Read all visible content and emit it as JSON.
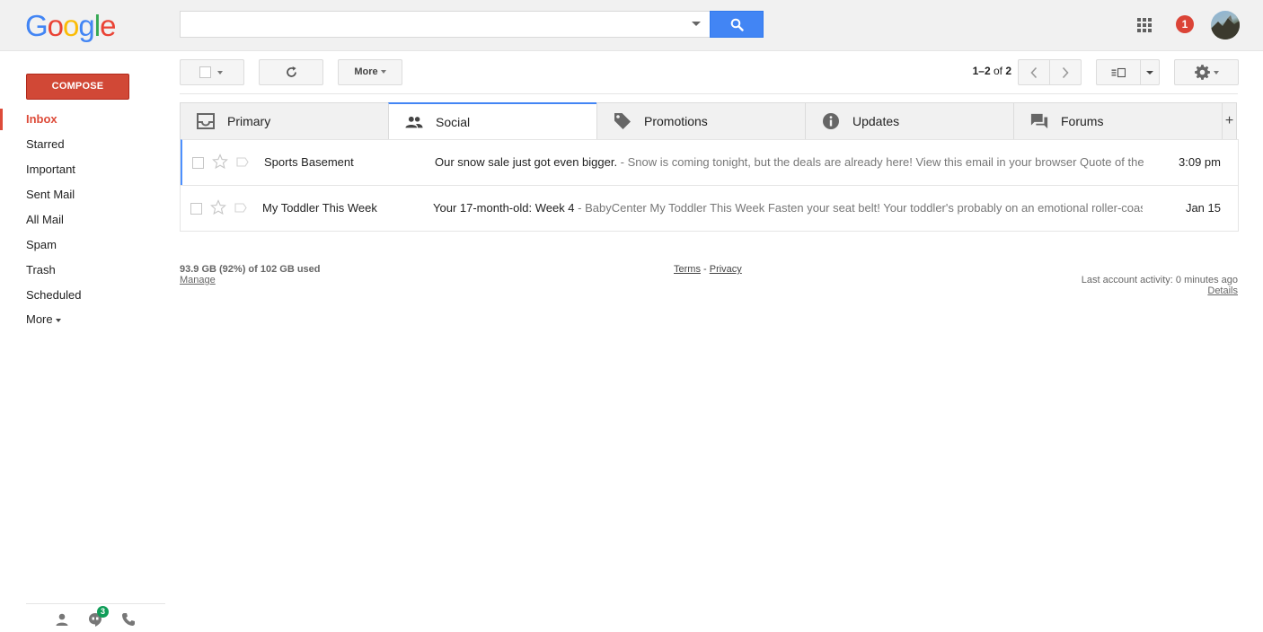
{
  "logo": {
    "letters": [
      "G",
      "o",
      "o",
      "g",
      "l",
      "e"
    ],
    "colors": [
      "#4285f4",
      "#ea4335",
      "#fbbc05",
      "#4285f4",
      "#34a853",
      "#ea4335"
    ]
  },
  "search": {
    "value": "",
    "placeholder": ""
  },
  "header": {
    "notification_count": "1"
  },
  "compose_label": "COMPOSE",
  "nav": {
    "items": [
      {
        "label": "Inbox"
      },
      {
        "label": "Starred"
      },
      {
        "label": "Important"
      },
      {
        "label": "Sent Mail"
      },
      {
        "label": "All Mail"
      },
      {
        "label": "Spam"
      },
      {
        "label": "Trash"
      },
      {
        "label": "Scheduled"
      }
    ],
    "more_label": "More"
  },
  "hangouts": {
    "badge": "3"
  },
  "toolbar": {
    "more_label": "More",
    "pager_range": "1–2",
    "pager_of": " of ",
    "pager_total": "2"
  },
  "tabs": [
    {
      "label": "Primary",
      "icon": "inbox-icon"
    },
    {
      "label": "Social",
      "icon": "people-icon"
    },
    {
      "label": "Promotions",
      "icon": "tag-icon"
    },
    {
      "label": "Updates",
      "icon": "info-icon"
    },
    {
      "label": "Forums",
      "icon": "forum-icon"
    }
  ],
  "tab_add": "+",
  "emails": [
    {
      "sender": "Sports Basement",
      "subject": "Our snow sale just got even bigger.",
      "snippet": " - Snow is coming tonight, but the deals are already here! View this email in your browser Quote of the day",
      "time": "3:09 pm"
    },
    {
      "sender": "My Toddler This Week",
      "subject": "Your 17-month-old: Week 4",
      "snippet": " - BabyCenter My Toddler This Week Fasten your seat belt! Your toddler's probably on an emotional roller-coaster",
      "time": "Jan 15"
    }
  ],
  "footer": {
    "storage": "93.9 GB (92%) of 102 GB used",
    "manage": "Manage",
    "terms": "Terms",
    "sep": " - ",
    "privacy": "Privacy",
    "activity": "Last account activity: 0 minutes ago",
    "details": "Details"
  }
}
